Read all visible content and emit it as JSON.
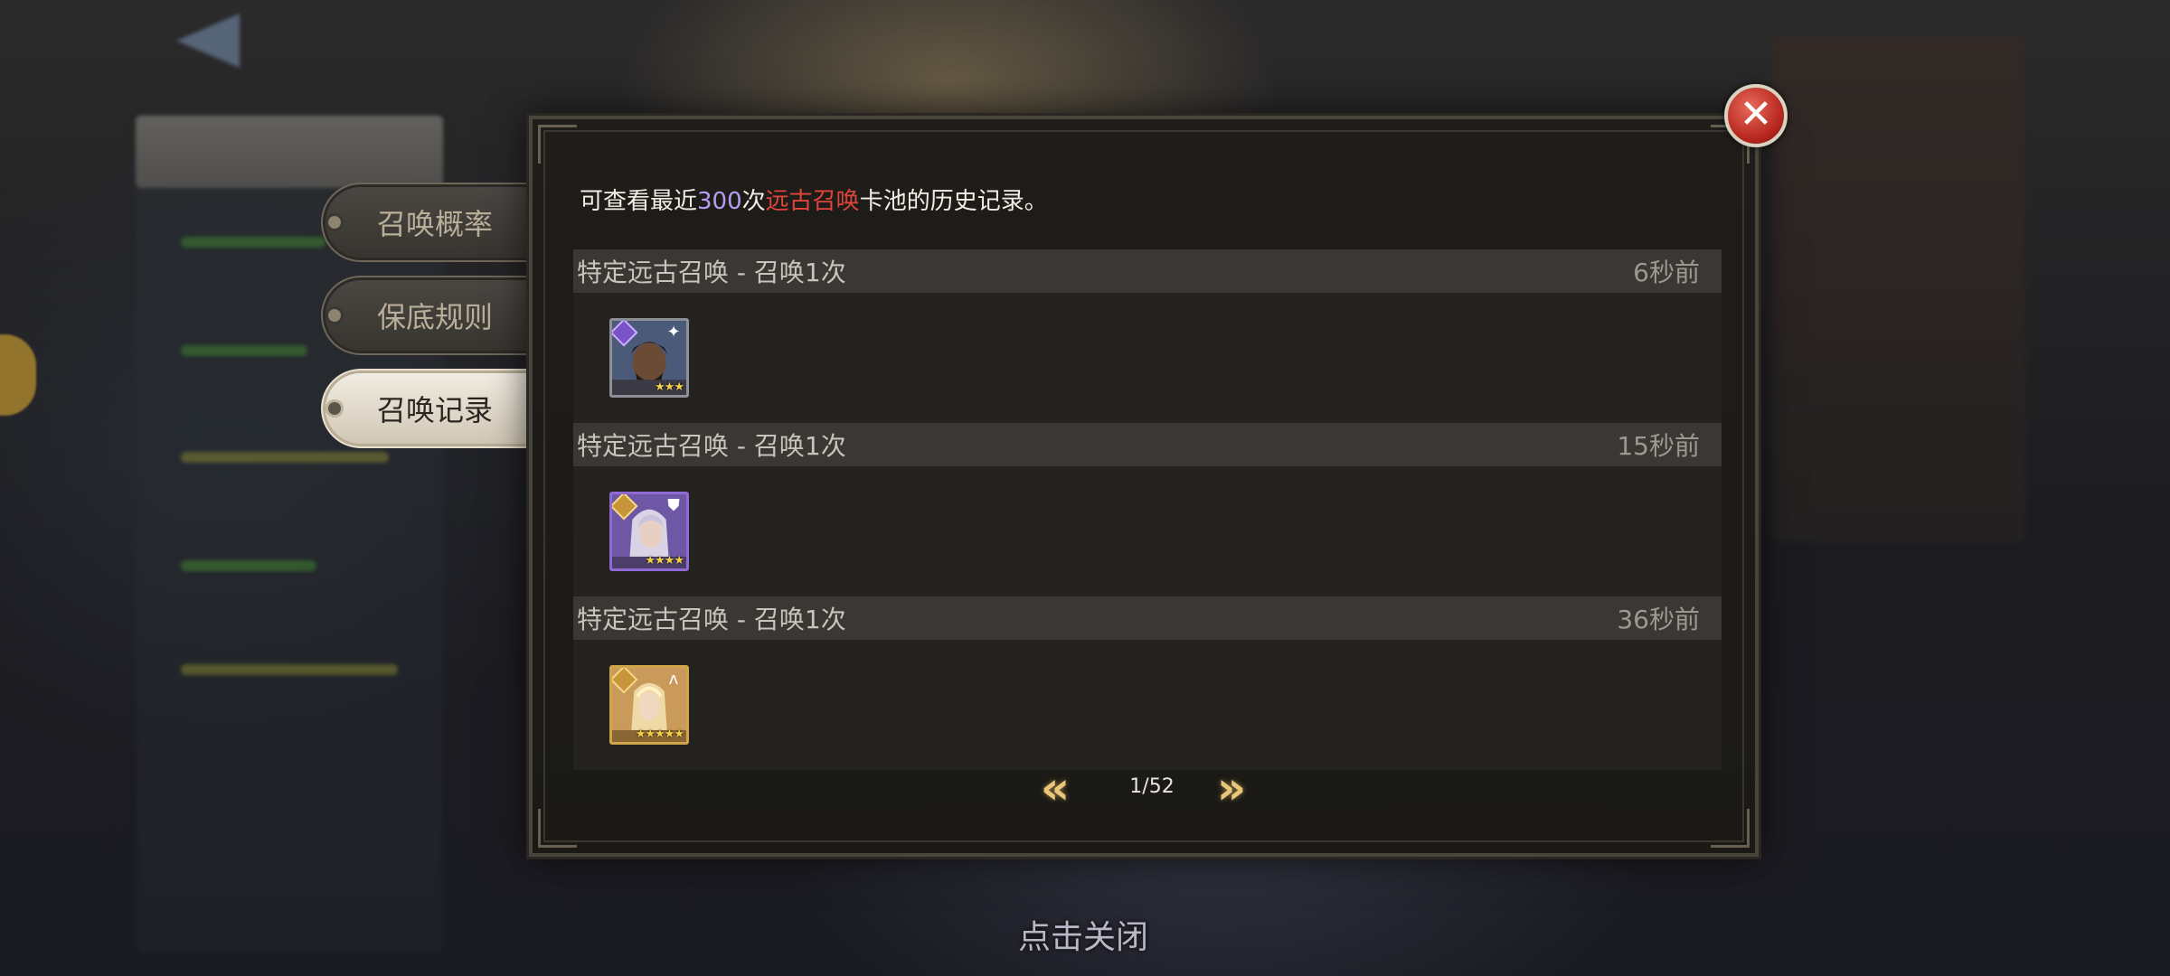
{
  "side_tabs": [
    {
      "label": "召唤概率",
      "active": false
    },
    {
      "label": "保底规则",
      "active": false
    },
    {
      "label": "召唤记录",
      "active": true
    }
  ],
  "intro": {
    "prefix": "可查看最近",
    "count": "300",
    "middle": "次",
    "pool_name": "远古召唤",
    "suffix": "卡池的历史记录。"
  },
  "records": [
    {
      "title": "特定远古召唤 - 召唤1次",
      "time": "6秒前",
      "hero": {
        "rarity": "silver",
        "stars": 3,
        "class_icon": "wand-icon"
      }
    },
    {
      "title": "特定远古召唤 - 召唤1次",
      "time": "15秒前",
      "hero": {
        "rarity": "purple",
        "stars": 4,
        "class_icon": "shield-icon"
      }
    },
    {
      "title": "特定远古召唤 - 召唤1次",
      "time": "36秒前",
      "hero": {
        "rarity": "gold",
        "stars": 5,
        "class_icon": "praying-hands-icon"
      }
    }
  ],
  "pager": {
    "label": "1/52",
    "current": 1,
    "total": 52
  },
  "close_hint": "点击关闭",
  "colors": {
    "count_highlight": "#b69cf0",
    "pool_highlight": "#e0443a",
    "pager_arrow": "#e9c77a"
  }
}
